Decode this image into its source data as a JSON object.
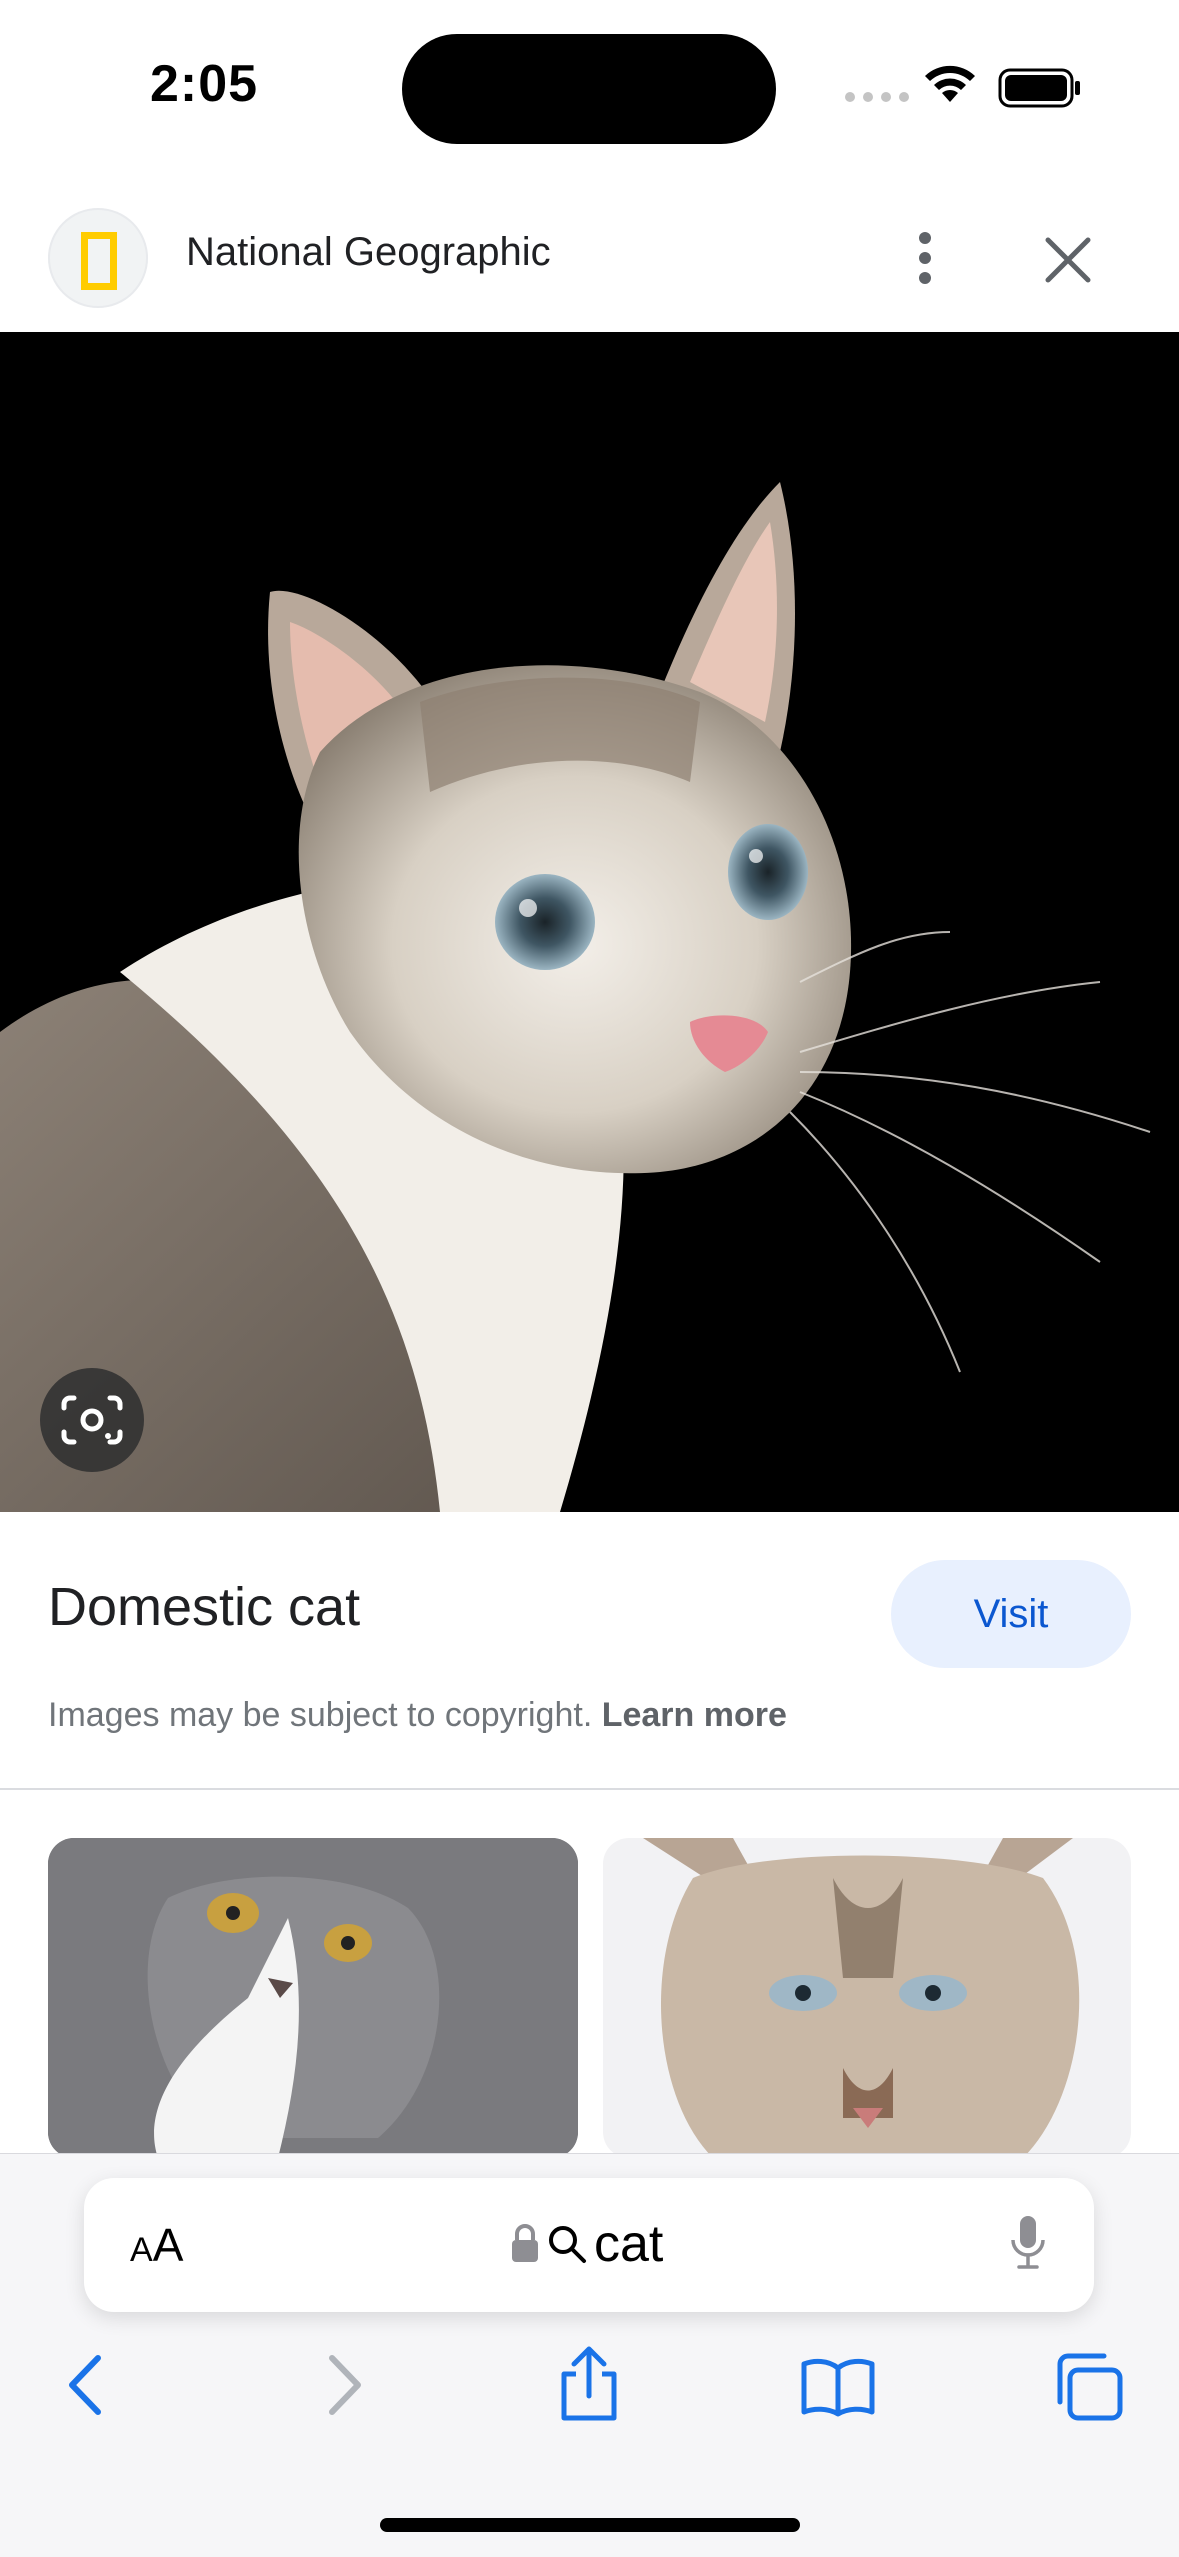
{
  "status_bar": {
    "time": "2:05"
  },
  "header": {
    "site_name": "National Geographic"
  },
  "result": {
    "title": "Domestic cat",
    "visit_label": "Visit",
    "copyright_text": "Images may be subject to copyright.",
    "learn_more": "Learn more"
  },
  "browser": {
    "text_size_label_small": "A",
    "text_size_label_large": "A",
    "search_query": "cat"
  },
  "colors": {
    "accent": "#0b57d0",
    "visit_bg": "#e8f0fe",
    "safari_blue": "#1a73e8",
    "natgeo_yellow": "#ffcc00"
  },
  "icons": [
    "natgeo-logo",
    "more-vert-icon",
    "close-icon",
    "google-lens-icon",
    "lock-icon",
    "search-icon",
    "mic-icon",
    "back-icon",
    "forward-icon",
    "share-icon",
    "bookmarks-icon",
    "tabs-icon"
  ]
}
